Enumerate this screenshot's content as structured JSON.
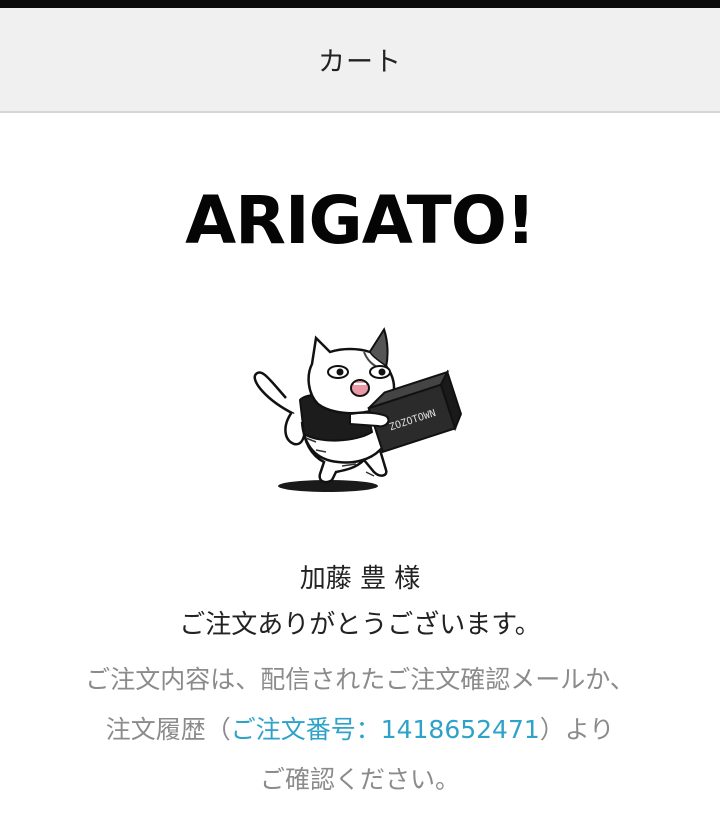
{
  "header": {
    "title": "カート"
  },
  "hero": {
    "title": "ARIGATO!"
  },
  "mascot": {
    "icon": "cat-carrying-box-illustration",
    "box_text": "ZOZOTOWN"
  },
  "message": {
    "customer_name": "加藤 豊 様",
    "thanks": "ご注文ありがとうございます。",
    "info_line1": "ご注文内容は、配信されたご注文確認メールか、",
    "info_line2_prefix": "注文履歴（",
    "order_link": "ご注文番号：1418652471",
    "info_line2_suffix": "）より",
    "info_line3": "ご確認ください。"
  },
  "colors": {
    "header_bg": "#f0f0f0",
    "text": "#222222",
    "muted_text": "#8b8b8b",
    "link": "#2ea2c9"
  }
}
